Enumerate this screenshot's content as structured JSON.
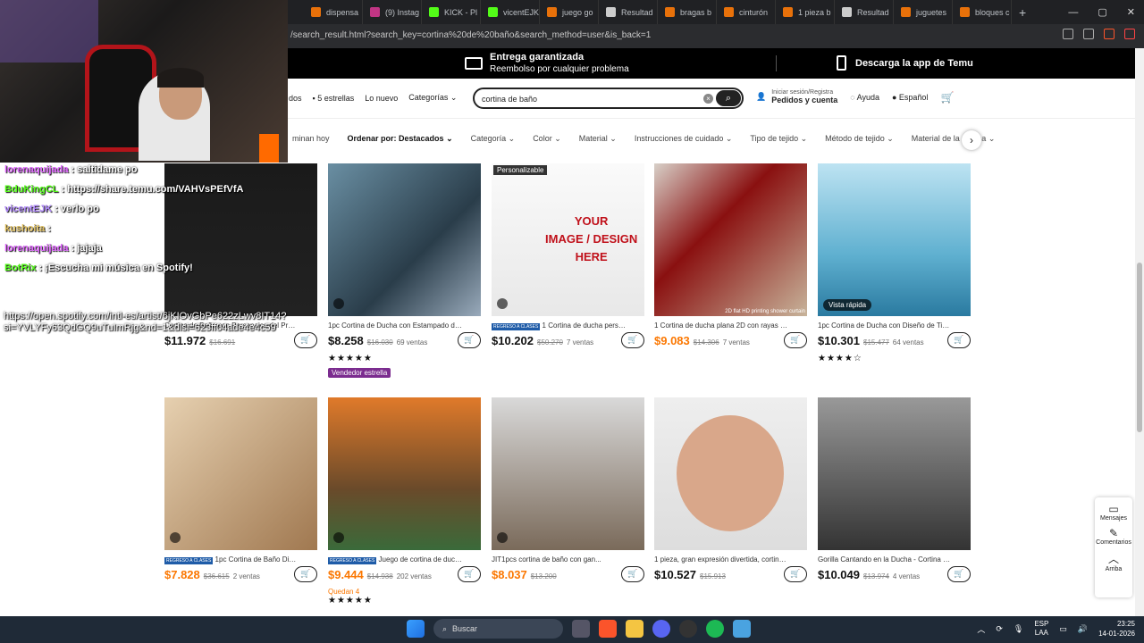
{
  "browser": {
    "tabs": [
      {
        "label": "dispensa",
        "color": "#e8710a"
      },
      {
        "label": "(9) Instag",
        "color": "#c13584"
      },
      {
        "label": "KICK - Pl",
        "color": "#53fc18"
      },
      {
        "label": "vicentEJK",
        "color": "#53fc18"
      },
      {
        "label": "juego go",
        "color": "#e8710a"
      },
      {
        "label": "Resultad",
        "color": "#cccccc"
      },
      {
        "label": "bragas b",
        "color": "#e8710a"
      },
      {
        "label": "cinturón",
        "color": "#e8710a"
      },
      {
        "label": "1 pieza b",
        "color": "#e8710a"
      },
      {
        "label": "Resultad",
        "color": "#cccccc"
      },
      {
        "label": "juguetes",
        "color": "#e8710a"
      },
      {
        "label": "bloques c",
        "color": "#e8710a"
      }
    ],
    "new_tab": "+",
    "url": "/search_result.html?search_key=cortina%20de%20baño&search_method=user&is_back=1"
  },
  "promo": {
    "title": "Entrega garantizada",
    "subtitle": "Reembolso por cualquier problema",
    "app": "Descarga la app de Temu"
  },
  "nav": {
    "partial": "dos",
    "stars": "5 estrellas",
    "new": "Lo nuevo",
    "categories": "Categorías",
    "search_value": "cortina de baño",
    "login_small": "Iniciar sesión/Registra",
    "login": "Pedidos y cuenta",
    "help": "Ayuda",
    "lang": "Español"
  },
  "filters": {
    "items": [
      "minan hoy",
      "Ordenar por: Destacados",
      "Categoría",
      "Color",
      "Material",
      "Instrucciones de cuidado",
      "Tipo de tejido",
      "Método de tejido",
      "Material de la cortina"
    ]
  },
  "products": [
    {
      "title": "Cortina de Baño con Personajes del Progra...",
      "price": "$11.972",
      "old": "$16.691",
      "sold": "",
      "orange": false,
      "badge": false
    },
    {
      "title": "1pc Cortina de Ducha con Estampado de A...",
      "price": "$8.258",
      "old": "$16.030",
      "sold": "69 ventas",
      "orange": false,
      "badge": false,
      "stars": "★★★★★",
      "seller": "Vendedor estrella"
    },
    {
      "title": "1 Cortina de ducha personalizad...",
      "price": "$10.202",
      "old": "$50.270",
      "sold": "7 ventas",
      "orange": false,
      "badge": true,
      "tag": "Personalizable"
    },
    {
      "title": "1 Cortina de ducha plana 2D con rayas de ...",
      "price": "$9.083",
      "old": "$14.306",
      "sold": "7 ventas",
      "orange": true,
      "badge": false,
      "imgtext": "2D flat HD printing shower curtain"
    },
    {
      "title": "1pc Cortina de Ducha con Diseño de Tibur...",
      "price": "$10.301",
      "old": "$15.477",
      "sold": "64 ventas",
      "orange": false,
      "badge": false,
      "stars": "★★★★☆",
      "quick": "Vista rápida"
    },
    {
      "title": "1pc Cortina de Baño Divertida p...",
      "price": "$7.828",
      "old": "$36.615",
      "sold": "2 ventas",
      "orange": true,
      "badge": true
    },
    {
      "title": "Juego de cortina de ducha con d...",
      "price": "$9.444",
      "old": "$14.938",
      "sold": "202 ventas",
      "orange": true,
      "badge": true,
      "quedan": "Quedan 4",
      "stars": "★★★★★"
    },
    {
      "title": "JIT1pcs cortina de baño con gan...",
      "price": "$8.037",
      "old": "$13.200",
      "sold": "",
      "orange": true,
      "badge": false
    },
    {
      "title": "1 pieza, gran expresión divertida, cortina d...",
      "price": "$10.527",
      "old": "$15.913",
      "sold": "",
      "orange": false,
      "badge": false
    },
    {
      "title": "Gorilla Cantando en la Ducha - Cortina de ...",
      "price": "$10.049",
      "old": "$13.974",
      "sold": "4 ventas",
      "orange": false,
      "badge": false
    }
  ],
  "badge_text": "REGRESO A CLASES",
  "side": {
    "messages": "Mensajes",
    "comments": "Comentarios",
    "top": "Arriba"
  },
  "chat": [
    {
      "user": "lorenaquijada",
      "color": "#e066ff",
      "text": ": saltidame po"
    },
    {
      "user": "BduKingCL",
      "color": "#53fc18",
      "text": ": https://share.temu.com/VAHVsPEfVfA"
    },
    {
      "user": "vicentEJK",
      "color": "#b48cff",
      "text": ": verlo po"
    },
    {
      "user": "kushoita",
      "color": "#e0c060",
      "text": ":"
    },
    {
      "user": "lorenaquijada",
      "color": "#e066ff",
      "text": ": jajaja"
    },
    {
      "user": "BotRix",
      "color": "#53fc18",
      "text": ": ¡Escucha mi música en Spotify!"
    }
  ],
  "spotify_link": "https://open.spotify.com/intl-es/artist/6jKIOvGbPe622zLwv8IT14?si=YVLYFy63QdGQ9uTuImRjg&nd=1&dlsi=623ff04ade4e4c59",
  "taskbar": {
    "search": "Buscar",
    "lang1": "ESP",
    "lang2": "LAA",
    "time": "23:25",
    "date": "14-01-2026"
  }
}
